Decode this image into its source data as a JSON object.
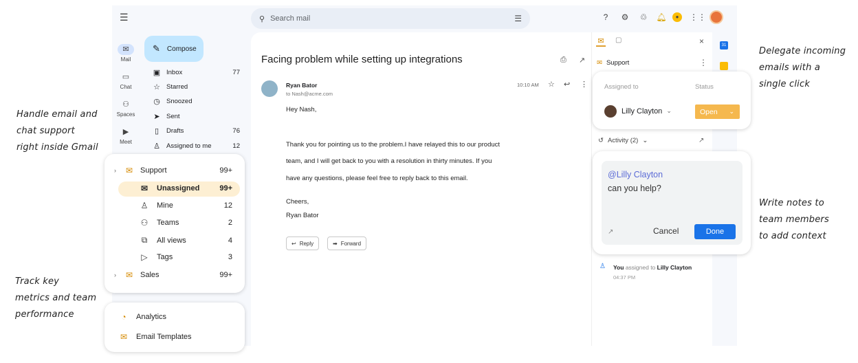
{
  "annotations": {
    "left_top": [
      "Handle email and",
      "chat support",
      "right inside Gmail"
    ],
    "left_bottom": [
      "Track key",
      "metrics and team",
      "performance"
    ],
    "right_top": [
      "Delegate incoming",
      "emails with a",
      "single click"
    ],
    "right_middle": [
      "Write notes to",
      "team members",
      "to add context"
    ]
  },
  "rail": {
    "menu_icon": "menu-icon",
    "items": [
      {
        "label": "Mail",
        "icon": "mail-icon"
      },
      {
        "label": "Chat",
        "icon": "chat-icon"
      },
      {
        "label": "Spaces",
        "icon": "spaces-icon"
      },
      {
        "label": "Meet",
        "icon": "meet-icon"
      }
    ]
  },
  "compose": {
    "label": "Compose"
  },
  "nav": [
    {
      "label": "Inbox",
      "count": "77"
    },
    {
      "label": "Starred",
      "count": ""
    },
    {
      "label": "Snoozed",
      "count": ""
    },
    {
      "label": "Sent",
      "count": ""
    },
    {
      "label": "Drafts",
      "count": "76"
    },
    {
      "label": "Assigned to me",
      "count": "12"
    }
  ],
  "search": {
    "placeholder": "Search mail"
  },
  "email": {
    "subject": "Facing problem while setting up integrations",
    "sender": "Ryan Bator",
    "to": "to Nash@acme.com",
    "time": "10:10 AM",
    "greeting": "Hey Nash,",
    "line1": "Thank you for pointing us to the problem.I have relayed this to our product",
    "line2": "team, and I will get back to you with a resolution in thirty minutes. If you",
    "line3": "have any questions, please feel free to reply back to this email.",
    "signoff": "Cheers,",
    "signature": "Ryan Bator",
    "reply_label": "Reply",
    "forward_label": "Forward"
  },
  "side_panel": {
    "inbox_label": "Support",
    "assigned_to_label": "Assigned to",
    "status_label": "Status",
    "assignee": "Lilly Clayton",
    "status_value": "Open",
    "activity_label": "Activity (2)",
    "note_mention": "@Lilly Clayton",
    "note_text": "can you help?",
    "cancel_label": "Cancel",
    "done_label": "Done",
    "log_actor": "You",
    "log_action": "assigned to",
    "log_target": "Lilly Clayton",
    "log_time": "04:37 PM",
    "calendar_badge": "31"
  },
  "overlay_inboxes": {
    "items": [
      {
        "label": "Support",
        "count": "99+"
      },
      {
        "label": "Unassigned",
        "count": "99+"
      },
      {
        "label": "Mine",
        "count": "12"
      },
      {
        "label": "Teams",
        "count": "2"
      },
      {
        "label": "All views",
        "count": "4"
      },
      {
        "label": "Tags",
        "count": "3"
      },
      {
        "label": "Sales",
        "count": "99+"
      }
    ]
  },
  "overlay_tools": {
    "analytics": "Analytics",
    "templates": "Email Templates"
  },
  "colors": {
    "accent": "#1a73e8",
    "highlight": "#fdefd3",
    "status": "#f5b84e",
    "mention": "#5b6bd6"
  }
}
